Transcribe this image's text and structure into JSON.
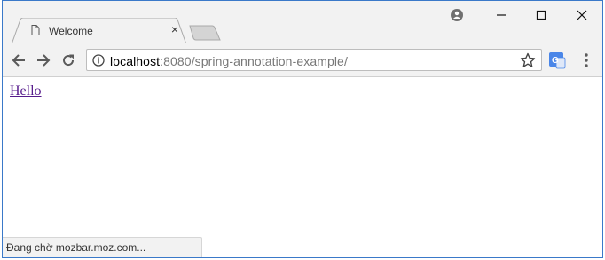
{
  "tab": {
    "title": "Welcome",
    "close_glyph": "×"
  },
  "address_bar": {
    "host": "localhost",
    "rest": ":8080/spring-annotation-example/"
  },
  "page": {
    "link_text": "Hello"
  },
  "status_bar": {
    "text": "Đang chờ mozbar.moz.com..."
  },
  "icons": {
    "page": "page-icon",
    "close": "close-icon",
    "new_tab": "new-tab-icon",
    "profile": "profile-icon",
    "minimize": "minimize-icon",
    "maximize": "maximize-icon",
    "window_close": "window-close-icon",
    "back": "back-arrow-icon",
    "forward": "forward-arrow-icon",
    "reload": "reload-icon",
    "info": "info-icon",
    "bookmark": "star-icon",
    "translate": "translate-extension-icon",
    "menu": "kebab-menu-icon"
  },
  "colors": {
    "frame": "#3a79c9",
    "chrome": "#f2f2f2",
    "link": "#551a8b",
    "translate": "#4a86e8"
  }
}
